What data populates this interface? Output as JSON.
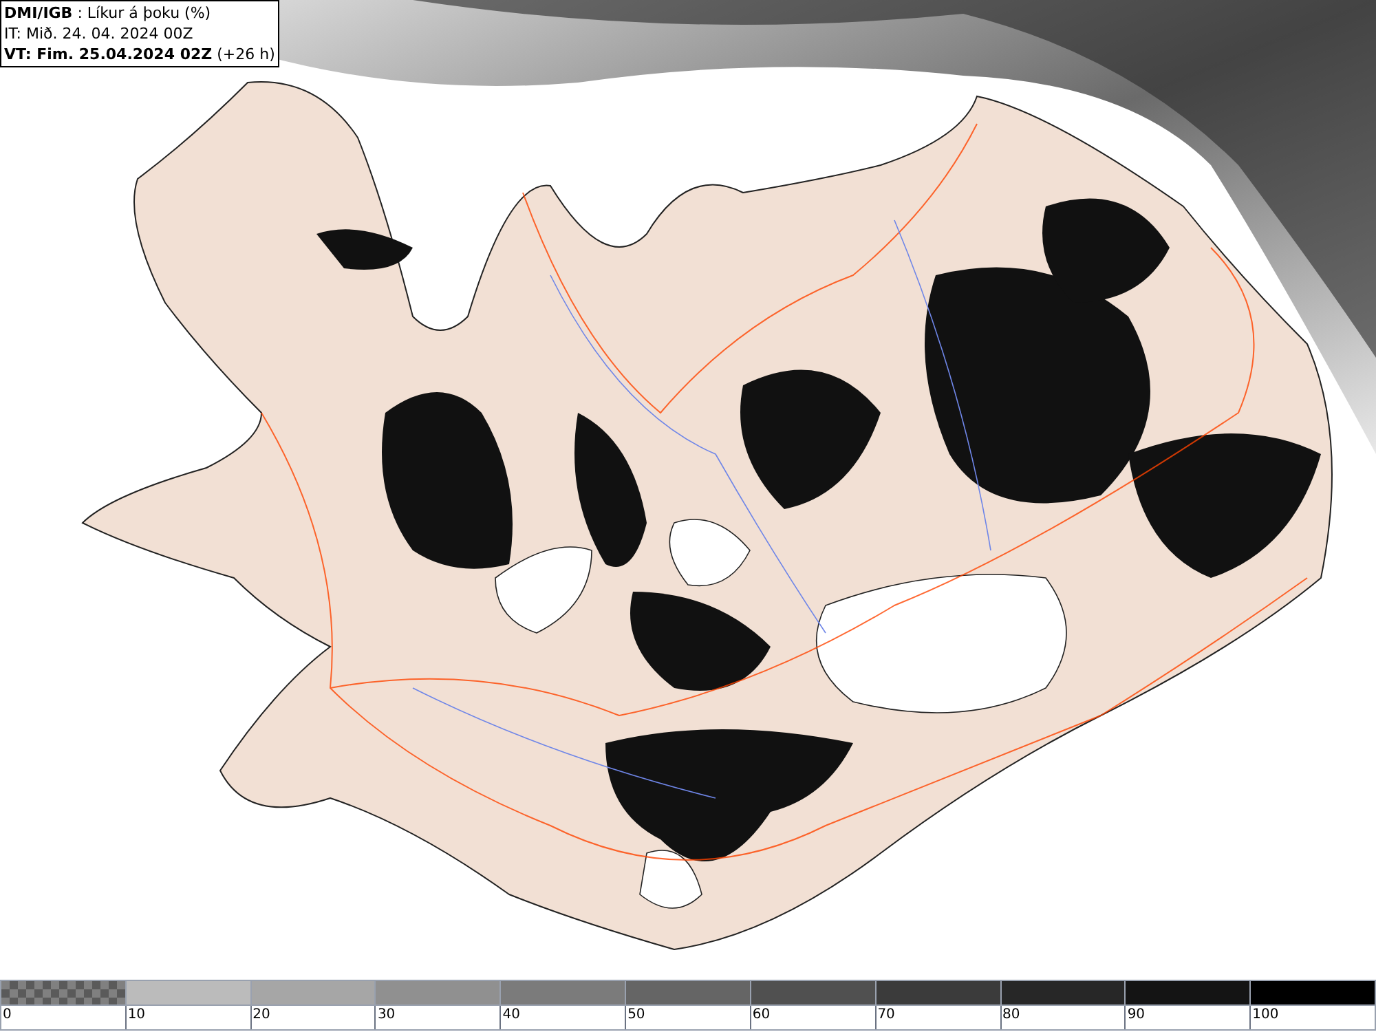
{
  "header": {
    "lines": [
      "**DMI/IGB** : Líkur á þoku (%)",
      "IT: Mið. 24. 04. 2024 00Z",
      "**VT: Fim. 25.04.2024 02Z** (+26 h)"
    ]
  },
  "legend": {
    "bins": [
      {
        "kind": "checker",
        "label": "0",
        "color": "#808080"
      },
      {
        "kind": "solid",
        "label": "10",
        "color": "#bbbbbb"
      },
      {
        "kind": "solid",
        "label": "20",
        "color": "#a6a6a6"
      },
      {
        "kind": "solid",
        "label": "30",
        "color": "#909090"
      },
      {
        "kind": "solid",
        "label": "40",
        "color": "#7b7b7b"
      },
      {
        "kind": "solid",
        "label": "50",
        "color": "#656565"
      },
      {
        "kind": "solid",
        "label": "60",
        "color": "#505050"
      },
      {
        "kind": "solid",
        "label": "70",
        "color": "#3b3b3b"
      },
      {
        "kind": "solid",
        "label": "80",
        "color": "#272727"
      },
      {
        "kind": "solid",
        "label": "90",
        "color": "#141414"
      },
      {
        "kind": "solid",
        "label": "100",
        "color": "#000000"
      }
    ]
  }
}
